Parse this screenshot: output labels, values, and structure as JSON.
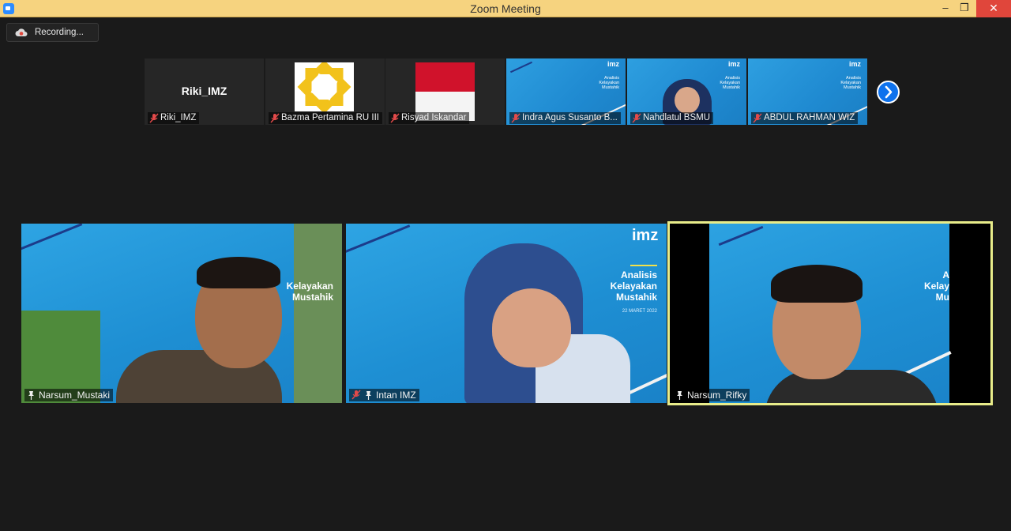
{
  "window": {
    "title": "Zoom Meeting",
    "minimize": "–",
    "maximize": "❐",
    "close": "✕"
  },
  "recording": {
    "label": "Recording..."
  },
  "strip": {
    "tiles": [
      {
        "name": "Riki_IMZ",
        "display_name": "Riki_IMZ",
        "muted": true
      },
      {
        "name": "Bazma Pertamina RU III",
        "muted": true
      },
      {
        "name": "Risyad Iskandar",
        "muted": true
      },
      {
        "name": "Indra Agus Susanto B...",
        "muted": true
      },
      {
        "name": "Nahdlatul BSMU",
        "muted": true
      },
      {
        "name": "ABDUL RAHMAN WIZ",
        "muted": true
      }
    ],
    "slide_mini": {
      "logo": "imz",
      "line1": "Analisis",
      "line2": "Kelayakan",
      "line3": "Mustahik"
    }
  },
  "videos": [
    {
      "name": "Narsum_Mustaki",
      "slide_line1": "Kelayakan",
      "slide_line2": "Mustahik",
      "pinned": true,
      "active": false
    },
    {
      "name": "Intan IMZ",
      "logo": "imz",
      "slide_line1": "Analisis",
      "slide_line2": "Kelayakan",
      "slide_line3": "Mustahik",
      "date": "22 MARET 2022",
      "muted": true,
      "pinned": true,
      "active": false
    },
    {
      "name": "Narsum_Rifky",
      "slide_line1": "A",
      "slide_line2": "Kelay",
      "slide_line3": "Mu",
      "pinned": true,
      "active": true
    }
  ],
  "colors": {
    "titlebar": "#f6d37f",
    "background": "#1a1a1a",
    "slide_blue": "#1f8fd4",
    "active_border": "#e8ec8a",
    "accent": "#0e72ed"
  }
}
